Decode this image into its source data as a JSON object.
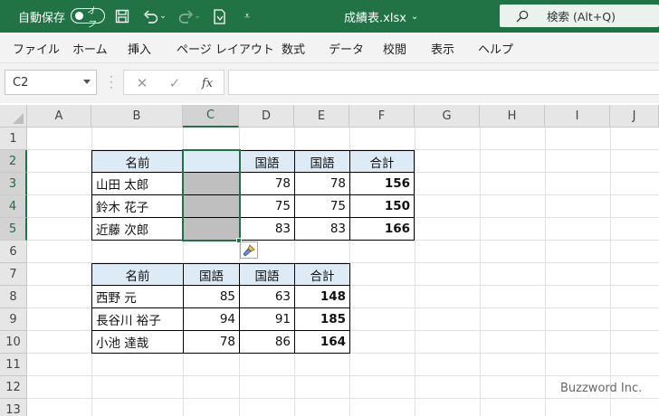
{
  "titlebar": {
    "autosave_label": "自動保存",
    "autosave_state": "オフ",
    "doc_title": "成績表.xlsx",
    "search_placeholder": "検索 (Alt+Q)",
    "bg_color": "#217346"
  },
  "ribbon": {
    "tabs": [
      "ファイル",
      "ホーム",
      "挿入",
      "ページ レイアウト",
      "数式",
      "データ",
      "校閲",
      "表示",
      "ヘルプ"
    ]
  },
  "formula_bar": {
    "name_box": "C2",
    "fx_label": "fx",
    "formula": ""
  },
  "grid": {
    "columns": [
      "A",
      "B",
      "C",
      "D",
      "E",
      "F",
      "G",
      "H",
      "I",
      "J"
    ],
    "rows": [
      "1",
      "2",
      "3",
      "4",
      "5",
      "6",
      "7",
      "8",
      "9",
      "10",
      "11",
      "12",
      "13"
    ],
    "selected_column": "C",
    "selected_rows": [
      "2",
      "3",
      "4",
      "5"
    ]
  },
  "table1": {
    "headers": [
      "名前",
      "",
      "国語",
      "国語",
      "合計"
    ],
    "rows": [
      {
        "name": "山田 太郎",
        "c": "",
        "d": "78",
        "e": "78",
        "total": "156"
      },
      {
        "name": "鈴木 花子",
        "c": "",
        "d": "75",
        "e": "75",
        "total": "150"
      },
      {
        "name": "近藤 次郎",
        "c": "",
        "d": "83",
        "e": "83",
        "total": "166"
      }
    ]
  },
  "table2": {
    "headers": [
      "名前",
      "国語",
      "国語",
      "合計"
    ],
    "rows": [
      {
        "name": "西野 元",
        "c": "85",
        "d": "63",
        "total": "148"
      },
      {
        "name": "長谷川 裕子",
        "c": "94",
        "d": "91",
        "total": "185"
      },
      {
        "name": "小池 達哉",
        "c": "78",
        "d": "86",
        "total": "164"
      }
    ]
  },
  "watermark": "Buzzword Inc.",
  "icons": {
    "save": "save-icon",
    "undo": "undo-icon",
    "redo": "redo-icon",
    "format_painter": "paintbrush-icon",
    "search": "search-icon"
  }
}
